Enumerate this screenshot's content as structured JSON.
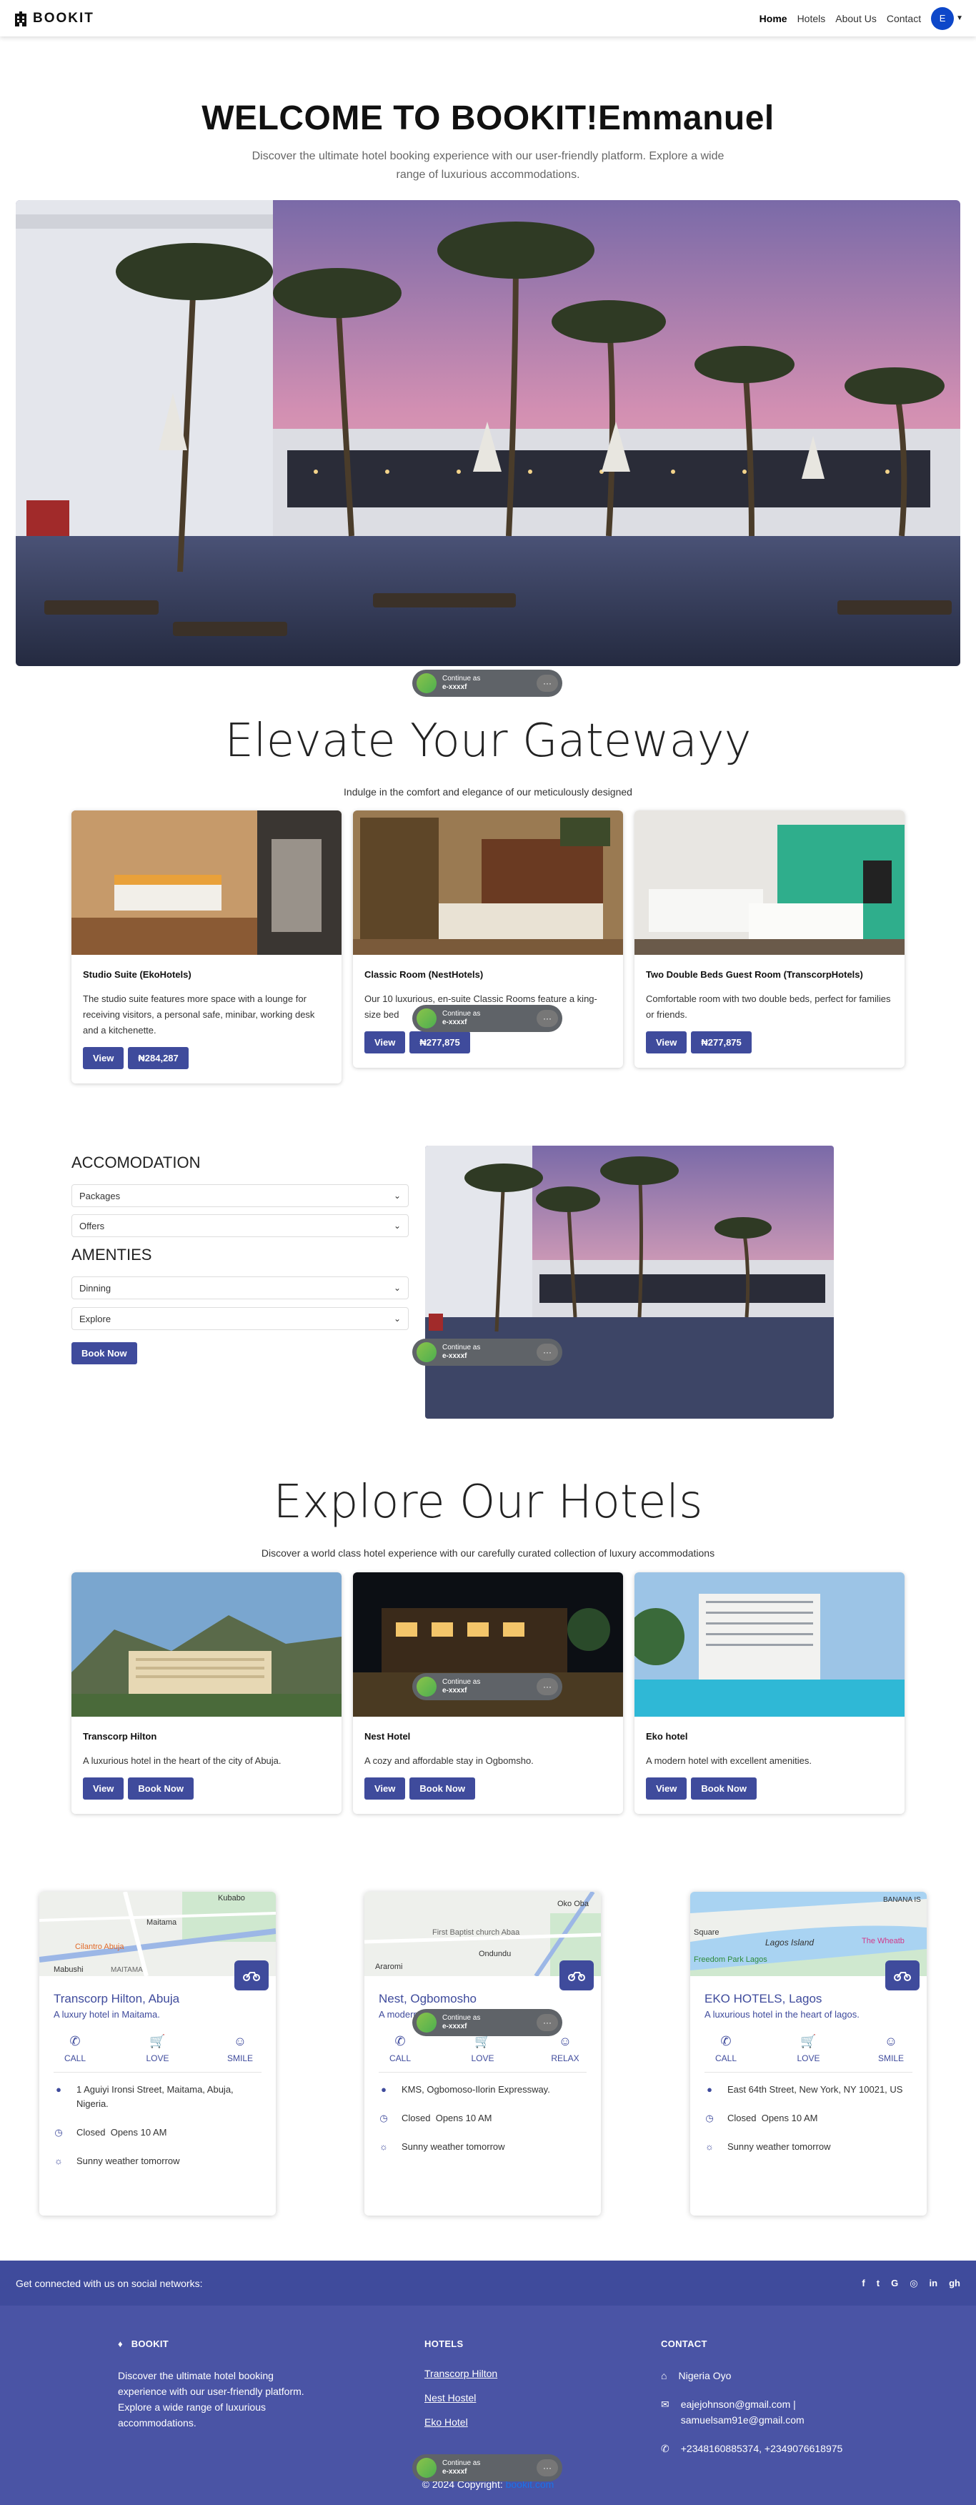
{
  "nav": {
    "brand": "BOOKIT",
    "links": [
      "Home",
      "Hotels",
      "About Us",
      "Contact"
    ],
    "avatar_letter": "E"
  },
  "hero": {
    "title": "WELCOME TO BOOKIT!Emmanuel",
    "subtitle": "Discover the ultimate hotel booking experience with our user-friendly platform. Explore a wide range of luxurious accommodations."
  },
  "google_chip": {
    "line1": "Continue as",
    "line2": "e-xxxxf",
    "more": "···"
  },
  "rooms_section": {
    "title": "Elevate Your Gatewayy",
    "subtitle": "Indulge in the comfort and elegance of our meticulously designed",
    "cards": [
      {
        "title": "Studio Suite (EkoHotels)",
        "text": "The studio suite features more space with a lounge for receiving visitors, a personal safe, minibar, working desk and a kitchenette.",
        "view": "View",
        "price": "₦284,287"
      },
      {
        "title": "Classic Room (NestHotels)",
        "text": "Our 10 luxurious, en-suite Classic Rooms feature a king-size bed",
        "view": "View",
        "price": "₦277,875"
      },
      {
        "title": "Two Double Beds Guest Room (TranscorpHotels)",
        "text": "Comfortable room with two double beds, perfect for families or friends.",
        "view": "View",
        "price": "₦277,875"
      }
    ]
  },
  "accordion": {
    "heading1": "ACCOMODATION",
    "items1": [
      "Packages",
      "Offers"
    ],
    "heading2": "AMENTIES",
    "items2": [
      "Dinning",
      "Explore"
    ],
    "book_button": "Book Now"
  },
  "hotels_section": {
    "title": "Explore Our Hotels",
    "subtitle": "Discover a world class hotel experience with our carefully curated collection of luxury accommodations",
    "cards": [
      {
        "title": "Transcorp Hilton",
        "text": "A luxurious hotel in the heart of the city of Abuja.",
        "view": "View",
        "book": "Book Now"
      },
      {
        "title": "Nest Hotel",
        "text": "A cozy and affordable stay in Ogbomsho.",
        "view": "View",
        "book": "Book Now"
      },
      {
        "title": "Eko hotel",
        "text": "A modern hotel with excellent amenities.",
        "view": "View",
        "book": "Book Now"
      }
    ]
  },
  "map_cards": [
    {
      "map_labels": [
        "Kubabo",
        "Maitama",
        "Cilantro Abuja",
        "Mabushi",
        "MAITAMA"
      ],
      "title": "Transcorp Hilton, Abuja",
      "subtitle": "A luxury hotel in Maitama.",
      "actions": [
        "CALL",
        "LOVE",
        "SMILE"
      ],
      "address": "1 Aguiyi Ironsi Street, Maitama, Abuja, Nigeria.",
      "status": "Closed",
      "opens": "Opens 10 AM",
      "weather": "Sunny weather tomorrow"
    },
    {
      "map_labels": [
        "Oko Oba",
        "First Baptist church Abaa",
        "Ondundu",
        "Araromi"
      ],
      "title": "Nest, Ogbomosho",
      "subtitle": "A modern hotel in Ogbomosho.",
      "actions": [
        "CALL",
        "LOVE",
        "RELAX"
      ],
      "address": "KMS, Ogbomoso-Ilorin Expressway.",
      "status": "Closed",
      "opens": "Opens 10 AM",
      "weather": "Sunny weather tomorrow"
    },
    {
      "map_labels": [
        "BANANA IS",
        "Square",
        "Lagos Island",
        "The Wheatb",
        "Freedom Park Lagos"
      ],
      "title": "EKO HOTELS, Lagos",
      "subtitle": "A luxurious hotel in the heart of lagos.",
      "actions": [
        "CALL",
        "LOVE",
        "SMILE"
      ],
      "address": "East 64th Street, New York, NY 10021, US",
      "status": "Closed",
      "opens": "Opens 10 AM",
      "weather": "Sunny weather tomorrow"
    }
  ],
  "footer": {
    "social_text": "Get connected with us on social networks:",
    "social_icons": [
      "f",
      "t",
      "G",
      "◎",
      "in",
      "gh"
    ],
    "brand_title": "BOOKIT",
    "brand_text": "Discover the ultimate hotel booking experience with our user-friendly platform. Explore a wide range of luxurious accommodations.",
    "hotels_title": "HOTELS",
    "hotel_links": [
      "Transcorp Hilton",
      "Nest Hostel",
      "Eko Hotel"
    ],
    "contact_title": "CONTACT",
    "location": "Nigeria Oyo",
    "emails": "eajejohnson@gmail.com | samuelsam91e@gmail.com",
    "phones": "+2348160885374, +2349076618975",
    "copyright": "© 2024 Copyright:",
    "copyright_link": "bookit.com"
  },
  "colors": {
    "primary": "#3f4b9c",
    "footer": "#4a54a5",
    "avatar": "#0d47c9"
  }
}
